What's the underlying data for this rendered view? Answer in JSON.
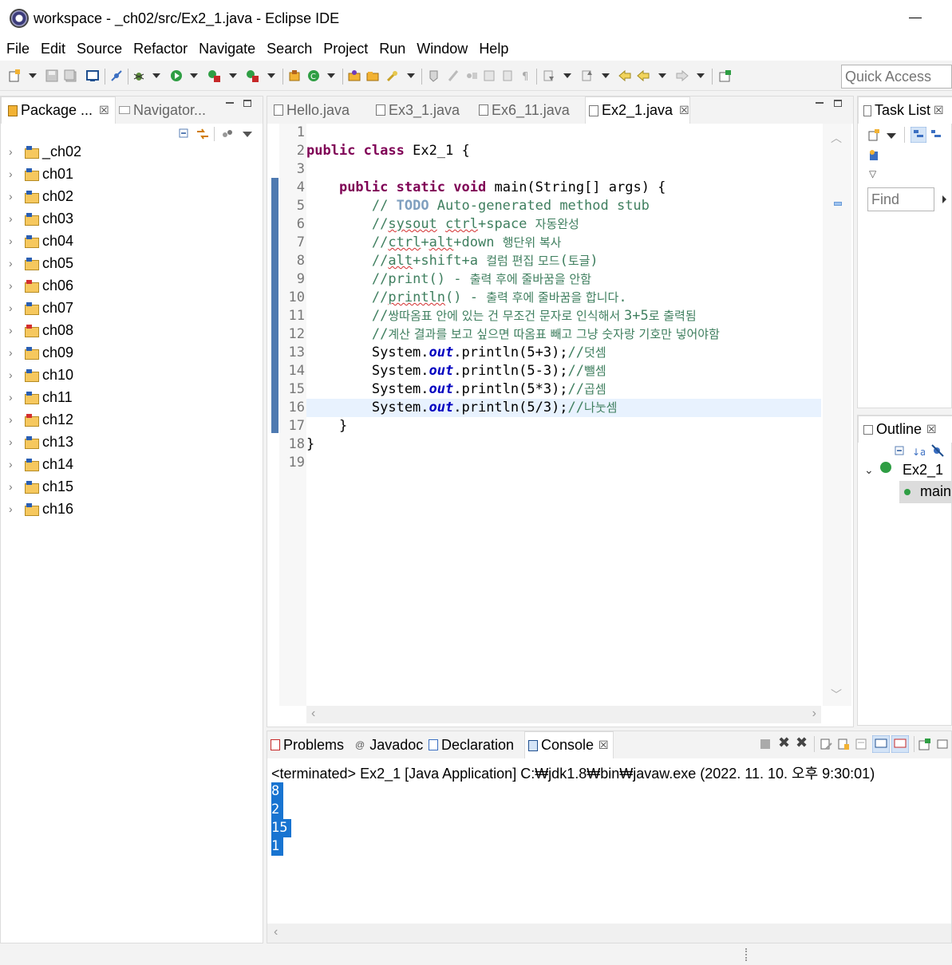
{
  "window": {
    "title": "workspace - _ch02/src/Ex2_1.java - Eclipse IDE"
  },
  "menu": [
    "File",
    "Edit",
    "Source",
    "Refactor",
    "Navigate",
    "Search",
    "Project",
    "Run",
    "Window",
    "Help"
  ],
  "quick_access": {
    "placeholder": "Quick Access"
  },
  "package_explorer": {
    "tabs": [
      {
        "label": "Package ...",
        "close": "☒"
      },
      {
        "label": "Navigator..."
      }
    ],
    "projects": [
      {
        "name": "_ch02",
        "error": false
      },
      {
        "name": "ch01",
        "error": false
      },
      {
        "name": "ch02",
        "error": false
      },
      {
        "name": "ch03",
        "error": false
      },
      {
        "name": "ch04",
        "error": false
      },
      {
        "name": "ch05",
        "error": false
      },
      {
        "name": "ch06",
        "error": true
      },
      {
        "name": "ch07",
        "error": false
      },
      {
        "name": "ch08",
        "error": true
      },
      {
        "name": "ch09",
        "error": false
      },
      {
        "name": "ch10",
        "error": false
      },
      {
        "name": "ch11",
        "error": false
      },
      {
        "name": "ch12",
        "error": true
      },
      {
        "name": "ch13",
        "error": false
      },
      {
        "name": "ch14",
        "error": false
      },
      {
        "name": "ch15",
        "error": false
      },
      {
        "name": "ch16",
        "error": false
      }
    ]
  },
  "editor": {
    "tabs": [
      {
        "label": "Hello.java",
        "active": false
      },
      {
        "label": "Ex3_1.java",
        "active": false
      },
      {
        "label": "Ex6_11.java",
        "active": false
      },
      {
        "label": "Ex2_1.java",
        "active": true
      }
    ],
    "line_numbers": [
      "1",
      "2",
      "3",
      "4",
      "5",
      "6",
      "7",
      "8",
      "9",
      "10",
      "11",
      "12",
      "13",
      "14",
      "15",
      "16",
      "17",
      "18",
      "19"
    ],
    "current_line": 16
  },
  "task_list": {
    "title": "Task List",
    "find_placeholder": "Find"
  },
  "outline": {
    "title": "Outline",
    "class_name": "Ex2_1",
    "method_name": "main"
  },
  "console": {
    "tabs": [
      {
        "label": "Problems"
      },
      {
        "label": "Javadoc"
      },
      {
        "label": "Declaration"
      },
      {
        "label": "Console",
        "active": true
      }
    ],
    "status_line": "<terminated> Ex2_1 [Java Application] C:₩jdk1.8₩bin₩javaw.exe (2022. 11. 10. 오후 9:30:01)",
    "output": [
      "8",
      "2",
      "15",
      "1"
    ]
  },
  "colors": {
    "keyword": "#7f0055",
    "comment": "#3f7f5f",
    "field": "#0000c0",
    "selection": "#1874d1"
  }
}
